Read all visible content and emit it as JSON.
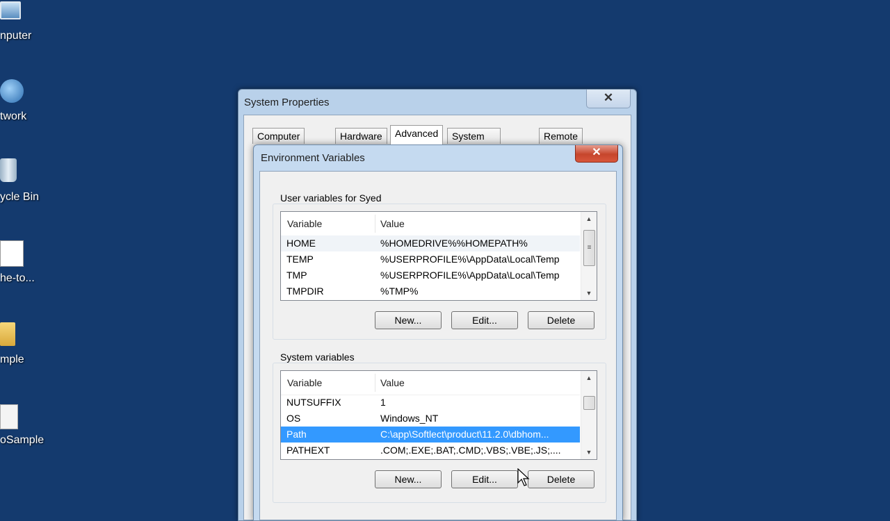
{
  "desktop": {
    "icons": [
      {
        "label": "nputer",
        "icon": "computer-icon"
      },
      {
        "label": "twork",
        "icon": "network-icon"
      },
      {
        "label": "ycle Bin",
        "icon": "recycle-bin-icon"
      },
      {
        "label": "he-to...",
        "icon": "tomcat-icon"
      },
      {
        "label": "mple",
        "icon": "folder-icon"
      },
      {
        "label": "oSample",
        "icon": "file-icon"
      }
    ]
  },
  "system_properties": {
    "title": "System Properties",
    "close": "✕",
    "tabs": [
      {
        "label": "Computer Name"
      },
      {
        "label": "Hardware"
      },
      {
        "label": "Advanced",
        "active": true
      },
      {
        "label": "System Protection"
      },
      {
        "label": "Remote"
      }
    ]
  },
  "env_vars": {
    "title": "Environment Variables",
    "close": "✕",
    "user_section": {
      "label": "User variables for Syed",
      "headers": {
        "variable": "Variable",
        "value": "Value"
      },
      "rows": [
        {
          "variable": "HOME",
          "value": "%HOMEDRIVE%%HOMEPATH%"
        },
        {
          "variable": "TEMP",
          "value": "%USERPROFILE%\\AppData\\Local\\Temp"
        },
        {
          "variable": "TMP",
          "value": "%USERPROFILE%\\AppData\\Local\\Temp"
        },
        {
          "variable": "TMPDIR",
          "value": "%TMP%"
        }
      ],
      "buttons": {
        "new": "New...",
        "edit": "Edit...",
        "delete": "Delete"
      }
    },
    "system_section": {
      "label": "System variables",
      "headers": {
        "variable": "Variable",
        "value": "Value"
      },
      "rows": [
        {
          "variable": "NUTSUFFIX",
          "value": "1"
        },
        {
          "variable": "OS",
          "value": "Windows_NT"
        },
        {
          "variable": "Path",
          "value": "C:\\app\\Softlect\\product\\11.2.0\\dbhom...",
          "selected": true
        },
        {
          "variable": "PATHEXT",
          "value": ".COM;.EXE;.BAT;.CMD;.VBS;.VBE;.JS;...."
        }
      ],
      "buttons": {
        "new": "New...",
        "edit": "Edit...",
        "delete": "Delete"
      }
    }
  },
  "colors": {
    "desktop": "#143a6e",
    "selection": "#3399ff",
    "close_red": "#c6452c"
  }
}
